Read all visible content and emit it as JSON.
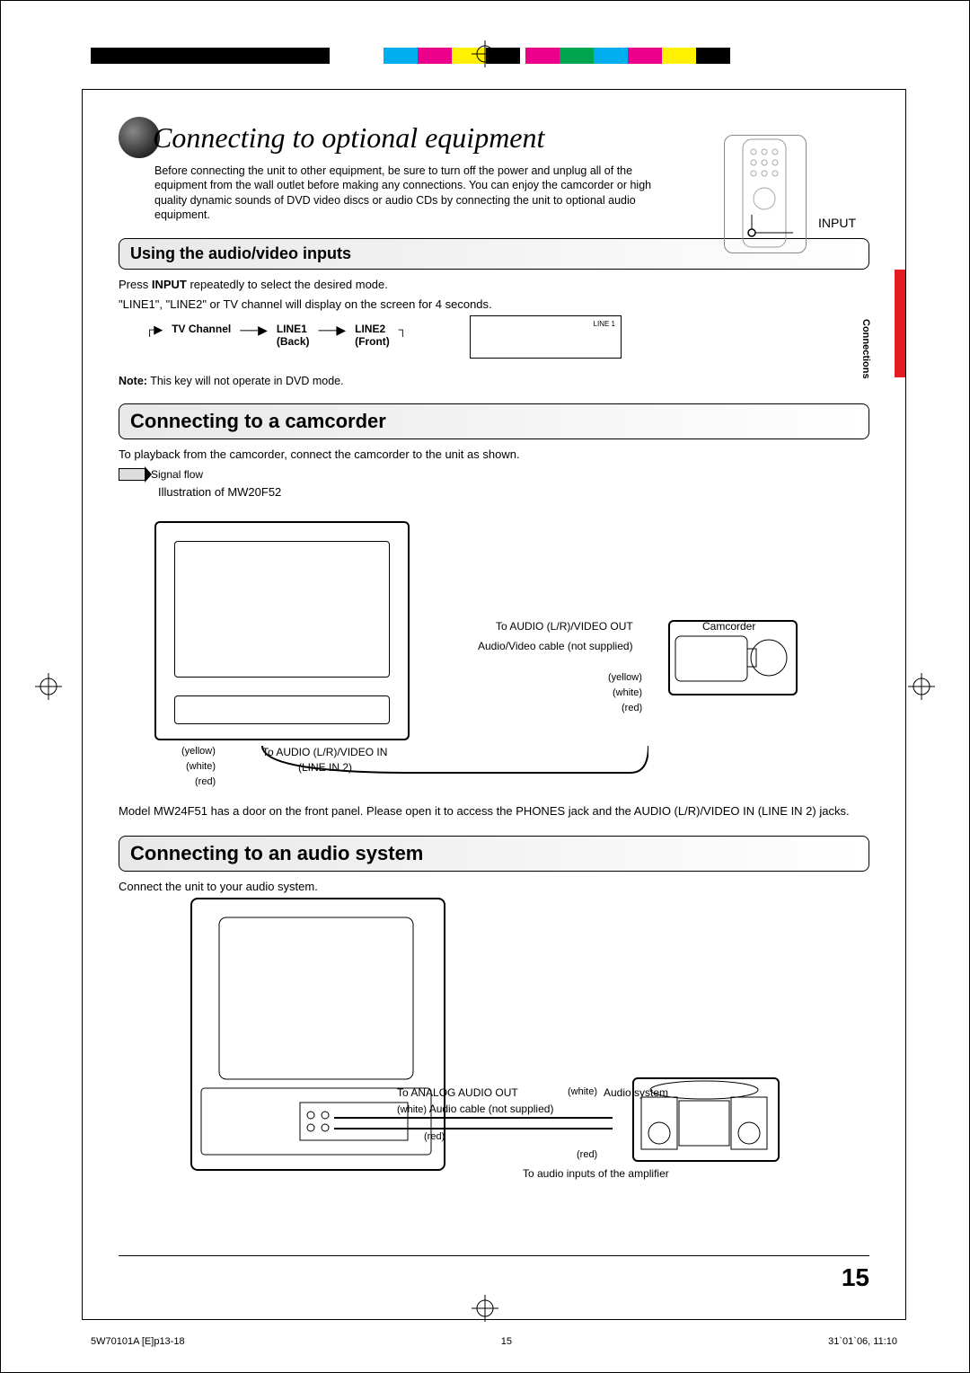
{
  "page_title": "Connecting to optional equipment",
  "intro": "Before connecting the unit to other equipment, be sure to turn off the power and unplug all of the equipment from the wall outlet before making any connections. You can enjoy the camcorder or high quality dynamic sounds of DVD video discs or audio CDs by connecting the unit to optional audio equipment.",
  "input_label": "INPUT",
  "side_tab": "Connections",
  "section1": {
    "title": "Using the audio/video inputs",
    "line1_a": "Press ",
    "line1_bold": "INPUT",
    "line1_b": " repeatedly to select the desired mode.",
    "line2": "\"LINE1\", \"LINE2\" or TV channel will display on the screen for 4 seconds.",
    "cycle": {
      "tv": "TV Channel",
      "l1": "LINE1",
      "l1_sub": "(Back)",
      "l2": "LINE2",
      "l2_sub": "(Front)"
    },
    "osd_text": "LINE 1",
    "note_bold": "Note:",
    "note_text": " This key will not operate in DVD mode."
  },
  "section2": {
    "title": "Connecting to a camcorder",
    "intro": "To playback from the camcorder, connect the camcorder to the unit as shown.",
    "signal_flow": "Signal flow",
    "illustration": "Illustration of MW20F52",
    "to_out": "To AUDIO (L/R)/VIDEO OUT",
    "camcorder": "Camcorder",
    "cable": "Audio/Video cable (not supplied)",
    "to_in": "To AUDIO (L/R)/VIDEO IN",
    "line_in2": "(LINE IN 2)",
    "yellow": "(yellow)",
    "white": "(white)",
    "red": "(red)",
    "model_note": "Model MW24F51 has a door on the front panel. Please open it to access the PHONES jack and the AUDIO (L/R)/VIDEO IN (LINE IN 2) jacks."
  },
  "section3": {
    "title": "Connecting to an audio system",
    "intro": "Connect the unit to your audio system.",
    "to_out": "To ANALOG AUDIO OUT",
    "cable": "Audio cable (not supplied)",
    "audio_system": "Audio system",
    "to_amp": "To audio inputs of the amplifier",
    "white": "(white)",
    "red": "(red)"
  },
  "page_number": "15",
  "footer": {
    "left": "5W70101A [E]p13-18",
    "center": "15",
    "right": "31`01`06, 11:10"
  },
  "reg_colors": [
    "#000",
    "#000",
    "#000",
    "#000",
    "#000",
    "#000",
    "#000",
    "#00aeef",
    "#ec008b",
    "#fff100",
    "#000",
    "#ec008b",
    "#00a550",
    "#00aeef",
    "#ec008b",
    "#fff100",
    "#000"
  ]
}
